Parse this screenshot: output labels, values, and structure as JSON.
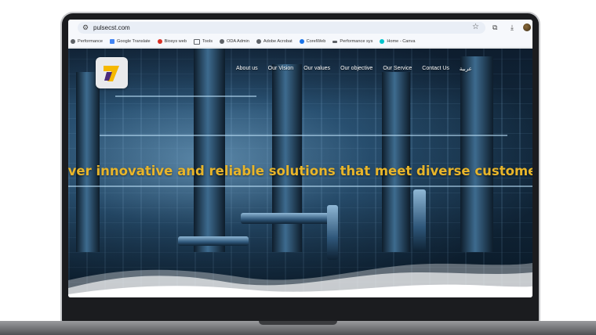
{
  "browser": {
    "url": "pulsecst.com",
    "bookmarks": [
      {
        "label": "Performance",
        "icon": "performance-icon",
        "color": "#5f6368"
      },
      {
        "label": "Google Translate",
        "icon": "translate-icon",
        "color": "#4285f4"
      },
      {
        "label": "Biosys web",
        "icon": "biosys-icon",
        "color": "#d93025"
      },
      {
        "label": "Tools",
        "icon": "folder-icon",
        "color": "#5f6368"
      },
      {
        "label": "ODA Admin",
        "icon": "globe-icon",
        "color": "#5f6368"
      },
      {
        "label": "Adobe Acrobat",
        "icon": "globe-icon",
        "color": "#5f6368"
      },
      {
        "label": "CorelWeb",
        "icon": "corel-icon",
        "color": "#1a73e8"
      },
      {
        "label": "Performance sys",
        "icon": "performance-sys-icon",
        "color": "#5f6368"
      },
      {
        "label": "Home - Canva",
        "icon": "canva-icon",
        "color": "#00c4cc"
      }
    ]
  },
  "site": {
    "nav": [
      "About us",
      "Our Vision",
      "Our values",
      "Our objective",
      "Our Service",
      "Contact Us",
      "عربية"
    ],
    "hero_text": "iver innovative and reliable solutions that meet diverse customer nee",
    "accent_color": "#e8b52a",
    "logo_colors": {
      "yellow": "#f5b800",
      "purple": "#4b2a7b"
    }
  }
}
